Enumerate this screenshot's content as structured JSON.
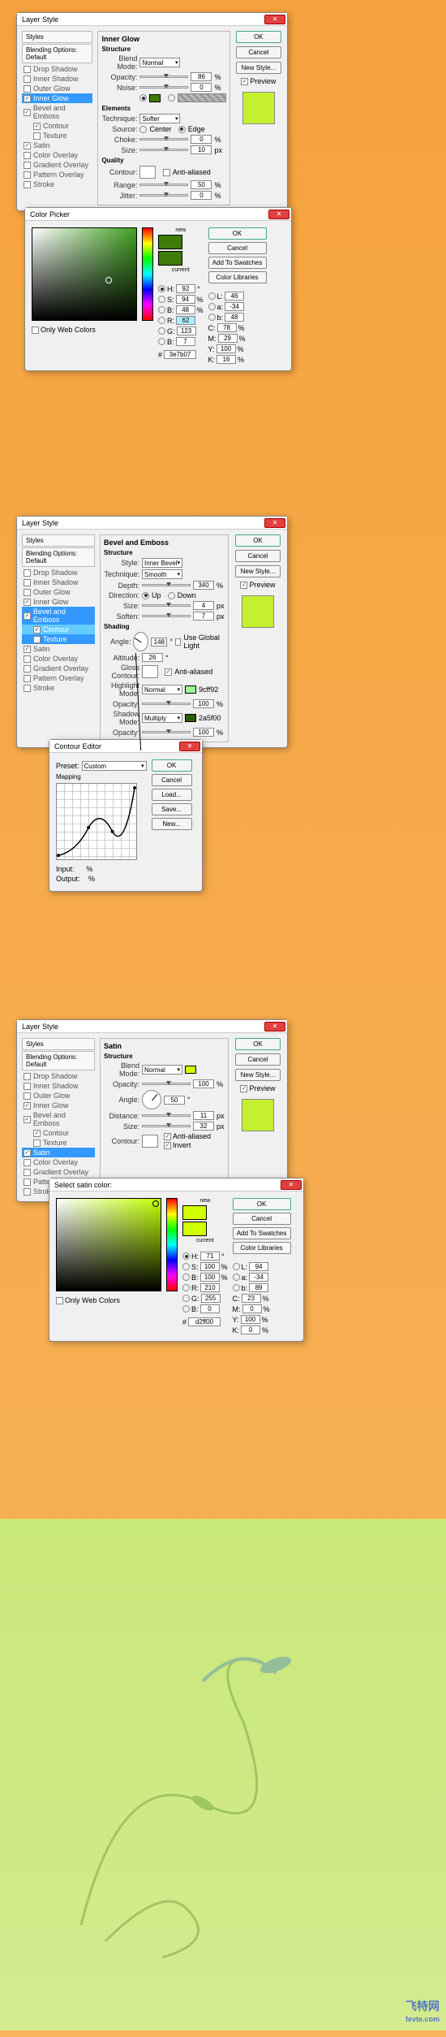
{
  "dialog1": {
    "title": "Layer Style",
    "styles_header": "Styles",
    "blending_options": "Blending Options: Default",
    "items": [
      "Drop Shadow",
      "Inner Shadow",
      "Outer Glow",
      "Inner Glow",
      "Bevel and Emboss",
      "Contour",
      "Texture",
      "Satin",
      "Color Overlay",
      "Gradient Overlay",
      "Pattern Overlay",
      "Stroke"
    ],
    "selected": "Inner Glow",
    "checked": [
      "Inner Glow",
      "Bevel and Emboss",
      "Contour",
      "Satin"
    ],
    "panel_title": "Inner Glow",
    "structure": "Structure",
    "elements": "Elements",
    "quality": "Quality",
    "blend_mode_lbl": "Blend Mode:",
    "blend_mode": "Normal",
    "opacity_lbl": "Opacity:",
    "opacity": "86",
    "noise_lbl": "Noise:",
    "noise": "0",
    "technique_lbl": "Technique:",
    "technique": "Softer",
    "source_lbl": "Source:",
    "center": "Center",
    "edge": "Edge",
    "choke_lbl": "Choke:",
    "choke": "0",
    "size_lbl": "Size:",
    "size": "10",
    "contour_lbl": "Contour:",
    "anti_aliased": "Anti-aliased",
    "range_lbl": "Range:",
    "range": "50",
    "jitter_lbl": "Jitter:",
    "jitter": "0",
    "ok": "OK",
    "cancel": "Cancel",
    "new_style": "New Style...",
    "preview": "Preview",
    "pct": "%",
    "px": "px"
  },
  "picker1": {
    "title": "Color Picker",
    "new_lbl": "new",
    "current_lbl": "current",
    "only_web": "Only Web Colors",
    "ok": "OK",
    "cancel": "Cancel",
    "add_swatches": "Add To Swatches",
    "color_libs": "Color Libraries",
    "H": "H:",
    "H_val": "92",
    "S": "S:",
    "S_val": "94",
    "B": "B:",
    "B_val": "48",
    "R": "R:",
    "R_val": "62",
    "G": "G:",
    "G_val": "123",
    "B2": "B:",
    "B2_val": "7",
    "L": "L:",
    "L_val": "46",
    "a": "a:",
    "a_val": "-34",
    "b": "b:",
    "b_val": "48",
    "C": "C:",
    "C_val": "78",
    "M": "M:",
    "M_val": "29",
    "Y": "Y:",
    "Y_val": "100",
    "K": "K:",
    "K_val": "16",
    "hex_lbl": "#",
    "hex": "3e7b07",
    "pct": "%",
    "deg": "°"
  },
  "dialog2": {
    "title": "Layer Style",
    "panel_title": "Bevel and Emboss",
    "structure": "Structure",
    "shading": "Shading",
    "style_lbl": "Style:",
    "style": "Inner Bevel",
    "technique_lbl": "Technique:",
    "technique": "Smooth",
    "depth_lbl": "Depth:",
    "depth": "340",
    "direction_lbl": "Direction:",
    "up": "Up",
    "down": "Down",
    "size_lbl": "Size:",
    "size": "4",
    "soften_lbl": "Soften:",
    "soften": "7",
    "angle_lbl": "Angle:",
    "angle": "148",
    "use_global": "Use Global Light",
    "altitude_lbl": "Altitude:",
    "altitude": "26",
    "gloss_lbl": "Gloss Contour:",
    "anti_aliased": "Anti-aliased",
    "highlight_lbl": "Highlight Mode:",
    "highlight": "Normal",
    "highlight_color": "9cff92",
    "opacity_lbl": "Opacity:",
    "h_opacity": "100",
    "shadow_lbl": "Shadow Mode:",
    "shadow": "Multiply",
    "shadow_color": "2a5f00",
    "s_opacity": "100",
    "selected": "Bevel and Emboss",
    "sub_selected": "Texture",
    "pct": "%",
    "px": "px",
    "deg": "°"
  },
  "contour": {
    "title": "Contour Editor",
    "preset_lbl": "Preset:",
    "preset": "Custom",
    "mapping": "Mapping",
    "input_lbl": "Input:",
    "output_lbl": "Output:",
    "ok": "OK",
    "cancel": "Cancel",
    "load": "Load...",
    "save": "Save...",
    "new": "New...",
    "pct": "%"
  },
  "dialog3": {
    "title": "Layer Style",
    "panel_title": "Satin",
    "structure": "Structure",
    "blend_mode_lbl": "Blend Mode:",
    "blend_mode": "Normal",
    "opacity_lbl": "Opacity:",
    "opacity": "100",
    "angle_lbl": "Angle:",
    "angle": "50",
    "distance_lbl": "Distance:",
    "distance": "11",
    "size_lbl": "Size:",
    "size": "32",
    "contour_lbl": "Contour:",
    "anti_aliased": "Anti-aliased",
    "invert": "Invert",
    "selected": "Satin",
    "pct": "%",
    "px": "px",
    "deg": "°"
  },
  "picker3": {
    "title": "Select satin color:",
    "H": "H:",
    "H_val": "71",
    "S": "S:",
    "S_val": "100",
    "B": "B:",
    "B_val": "100",
    "R": "R:",
    "R_val": "210",
    "G": "G:",
    "G_val": "255",
    "B2": "B:",
    "B2_val": "0",
    "L": "L:",
    "L_val": "94",
    "a": "a:",
    "a_val": "-34",
    "b": "b:",
    "b_val": "89",
    "C": "C:",
    "C_val": "23",
    "M": "M:",
    "M_val": "0",
    "Y": "Y:",
    "Y_val": "100",
    "K": "K:",
    "K_val": "0",
    "hex": "d2ff00"
  },
  "watermark": "fevte.com"
}
